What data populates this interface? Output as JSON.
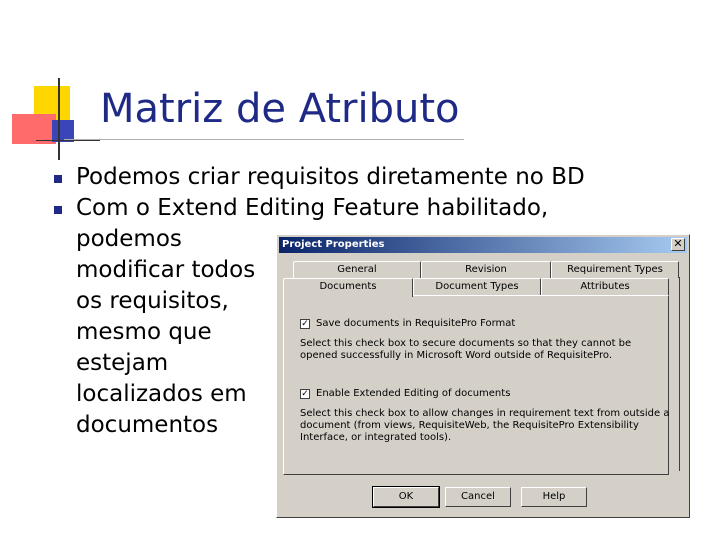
{
  "slide": {
    "title": "Matriz de Atributo",
    "bullets": [
      {
        "text": "Podemos criar requisitos diretamente no BD"
      },
      {
        "text": "Com o Extend Editing Feature habilitado,",
        "continuation": [
          "podemos",
          "modificar todos",
          "os requisitos,",
          "mesmo que",
          "estejam",
          "localizados em",
          "documentos"
        ]
      }
    ]
  },
  "dialog": {
    "title": "Project Properties",
    "close_glyph": "✕",
    "tabs_back": [
      "General",
      "Revision",
      "Requirement Types"
    ],
    "tabs_front": [
      "Documents",
      "Document Types",
      "Attributes"
    ],
    "active_tab": "Documents",
    "options": [
      {
        "checked": true,
        "check_glyph": "✓",
        "label": "Save documents in RequisitePro Format",
        "description": "Select this check box to secure documents so that they cannot be opened successfully in Microsoft Word outside of RequisitePro."
      },
      {
        "checked": true,
        "check_glyph": "✓",
        "label": "Enable Extended Editing of documents",
        "description": "Select this check box to allow changes in requirement text from outside a document (from views, RequisiteWeb, the RequisitePro Extensibility Interface, or integrated tools)."
      }
    ],
    "buttons": {
      "ok": "OK",
      "cancel": "Cancel",
      "help": "Help"
    }
  },
  "colors": {
    "title": "#1f2a86",
    "bullet": "#1f2a86",
    "titlebar_start": "#0a246a",
    "titlebar_end": "#a6caf0",
    "dialog_face": "#d4d0c8",
    "deco_yellow": "#ffd700",
    "deco_red": "#ff5050",
    "deco_blue": "#2a3bb0"
  }
}
